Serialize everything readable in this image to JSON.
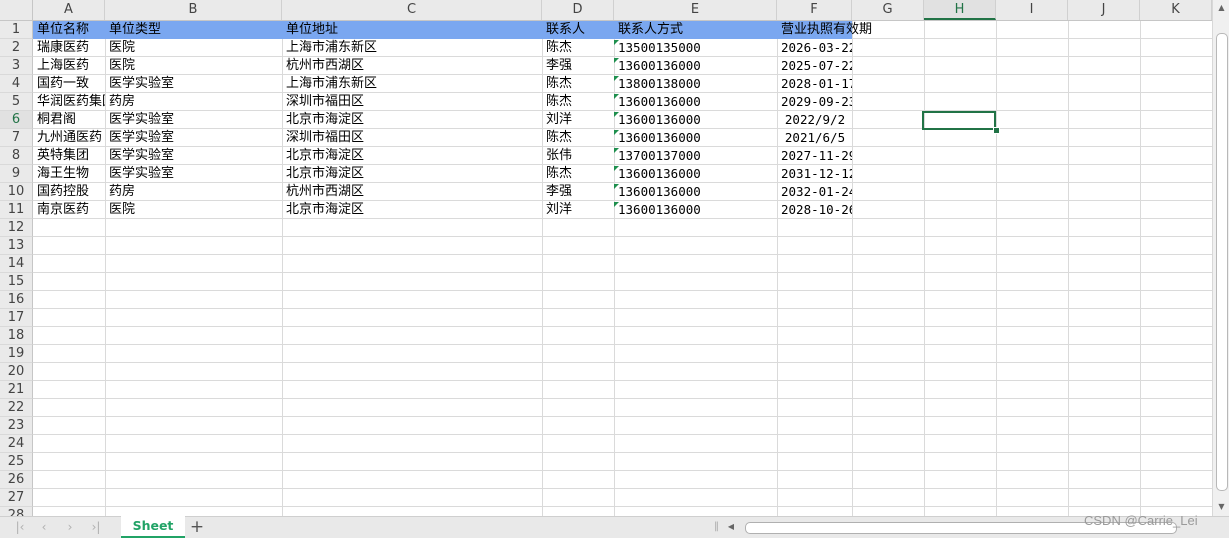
{
  "columns": [
    "A",
    "B",
    "C",
    "D",
    "E",
    "F",
    "G",
    "H",
    "I",
    "J",
    "K"
  ],
  "active_column": "H",
  "active_row": "6",
  "rows": [
    "1",
    "2",
    "3",
    "4",
    "5",
    "6",
    "7",
    "8",
    "9",
    "10",
    "11",
    "12",
    "13",
    "14",
    "15",
    "16",
    "17",
    "18",
    "19",
    "20",
    "21",
    "22",
    "23",
    "24",
    "25",
    "26",
    "27",
    "28"
  ],
  "header": {
    "name": "单位名称",
    "type": "单位类型",
    "address": "单位地址",
    "contact": "联系人",
    "phone": "联系人方式",
    "expiry": "营业执照有效期"
  },
  "records": [
    {
      "name": "瑞康医药",
      "type": "医院",
      "address": "上海市浦东新区",
      "contact": "陈杰",
      "phone": "13500135000",
      "expiry": "2026-03-22"
    },
    {
      "name": "上海医药",
      "type": "医院",
      "address": "杭州市西湖区",
      "contact": "李强",
      "phone": "13600136000",
      "expiry": "2025-07-22"
    },
    {
      "name": "国药一致",
      "type": "医学实验室",
      "address": "上海市浦东新区",
      "contact": "陈杰",
      "phone": "13800138000",
      "expiry": "2028-01-17"
    },
    {
      "name": "华润医药集团",
      "type": "药房",
      "address": "深圳市福田区",
      "contact": "陈杰",
      "phone": "13600136000",
      "expiry": "2029-09-23"
    },
    {
      "name": "桐君阁",
      "type": "医学实验室",
      "address": "北京市海淀区",
      "contact": "刘洋",
      "phone": "13600136000",
      "expiry": "2022/9/2"
    },
    {
      "name": "九州通医药",
      "type": "医学实验室",
      "address": "深圳市福田区",
      "contact": "陈杰",
      "phone": "13600136000",
      "expiry": "2021/6/5"
    },
    {
      "name": "英特集团",
      "type": "医学实验室",
      "address": "北京市海淀区",
      "contact": "张伟",
      "phone": "13700137000",
      "expiry": "2027-11-29"
    },
    {
      "name": "海王生物",
      "type": "医学实验室",
      "address": "北京市海淀区",
      "contact": "陈杰",
      "phone": "13600136000",
      "expiry": "2031-12-12"
    },
    {
      "name": "国药控股",
      "type": "药房",
      "address": "杭州市西湖区",
      "contact": "李强",
      "phone": "13600136000",
      "expiry": "2032-01-24"
    },
    {
      "name": "南京医药",
      "type": "医院",
      "address": "北京市海淀区",
      "contact": "刘洋",
      "phone": "13600136000",
      "expiry": "2028-10-26"
    }
  ],
  "sheet_tab": "Sheet",
  "add_sheet_label": "+",
  "watermark": "CSDN @Carrie_Lei",
  "colors": {
    "header_fill": "#7aa7f0",
    "accent": "#217346",
    "tab_text": "#21a366"
  }
}
